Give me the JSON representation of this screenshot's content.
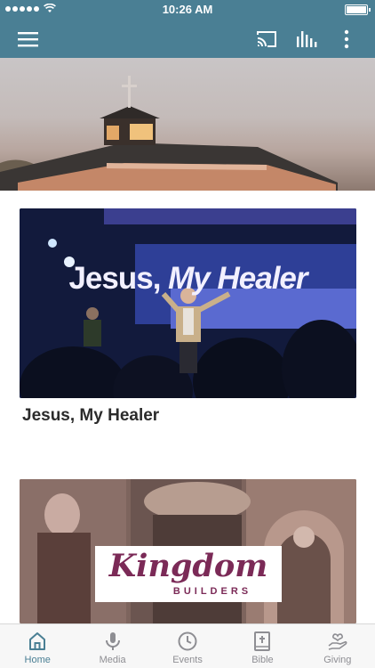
{
  "status": {
    "time": "10:26 AM"
  },
  "appbar": {
    "menu_icon": "hamburger-menu-icon",
    "cast_icon": "cast-icon",
    "audio_icon": "audio-levels-icon",
    "more_icon": "vertical-dots-icon"
  },
  "colors": {
    "brand": "#4a7f94",
    "tab_inactive": "#8e8e93"
  },
  "cards": [
    {
      "title": "Jesus, My Healer",
      "banner_main": "Jesus,",
      "banner_italic": "My Healer"
    },
    {
      "logo_script": "Kingdom",
      "logo_sub": "BUILDERS"
    }
  ],
  "tabs": [
    {
      "label": "Home",
      "icon": "home-icon",
      "active": true
    },
    {
      "label": "Media",
      "icon": "microphone-icon",
      "active": false
    },
    {
      "label": "Events",
      "icon": "clock-icon",
      "active": false
    },
    {
      "label": "Bible",
      "icon": "bible-icon",
      "active": false
    },
    {
      "label": "Giving",
      "icon": "giving-hand-icon",
      "active": false
    }
  ]
}
